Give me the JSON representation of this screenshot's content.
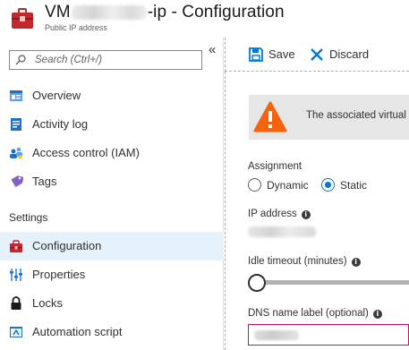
{
  "header": {
    "title_prefix": "VM",
    "title_suffix": "-ip - Configuration",
    "subtitle": "Public IP address"
  },
  "sidebar": {
    "search_placeholder": "Search (Ctrl+/)",
    "collapse_glyph": "«",
    "items_top": [
      {
        "label": "Overview",
        "icon": "overview-icon"
      },
      {
        "label": "Activity log",
        "icon": "activity-log-icon"
      },
      {
        "label": "Access control (IAM)",
        "icon": "iam-icon"
      },
      {
        "label": "Tags",
        "icon": "tag-icon"
      }
    ],
    "settings_label": "Settings",
    "items_settings": [
      {
        "label": "Configuration",
        "icon": "toolbox-icon",
        "active": true
      },
      {
        "label": "Properties",
        "icon": "properties-icon"
      },
      {
        "label": "Locks",
        "icon": "lock-icon"
      },
      {
        "label": "Automation script",
        "icon": "automation-script-icon"
      }
    ]
  },
  "toolbar": {
    "save_label": "Save",
    "discard_label": "Discard"
  },
  "main": {
    "warning_text": "The associated virtual",
    "assignment": {
      "label": "Assignment",
      "options": [
        "Dynamic",
        "Static"
      ],
      "selected": "Static"
    },
    "ip_address_label": "IP address",
    "idle_timeout_label": "Idle timeout (minutes)",
    "idle_timeout_fraction": 0,
    "dns_label": "DNS name label (optional)"
  },
  "colors": {
    "accent": "#0078d4",
    "warning": "#f7630c",
    "active_nav": "#e5f1fb",
    "resource_icon": "#c4262e",
    "dns_border": "#c50f6d"
  }
}
